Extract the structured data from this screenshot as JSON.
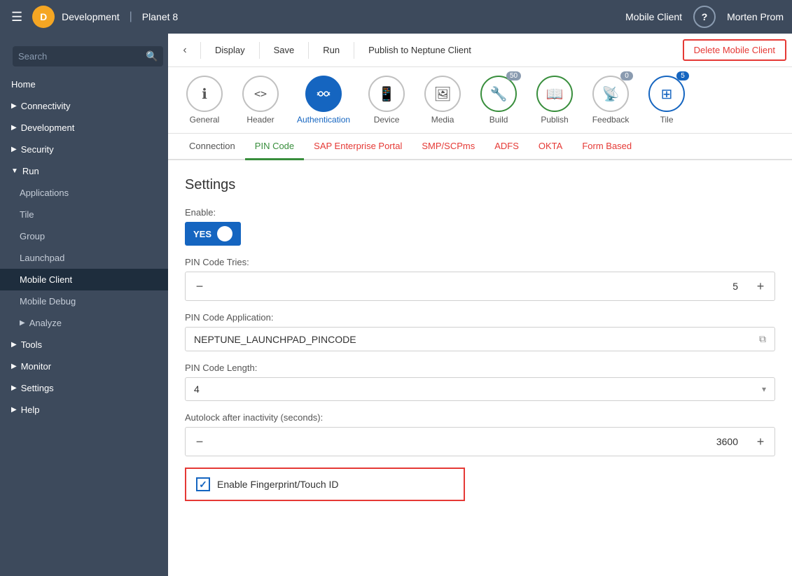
{
  "topbar": {
    "logo_text": "D",
    "environment": "Development",
    "separator": "|",
    "project": "Planet 8",
    "mobile_client": "Mobile Client",
    "help_label": "?",
    "user": "Morten Prom"
  },
  "sidebar": {
    "search_placeholder": "Search",
    "items": [
      {
        "id": "home",
        "label": "Home",
        "expandable": false,
        "indent": 0
      },
      {
        "id": "connectivity",
        "label": "Connectivity",
        "expandable": true,
        "indent": 0
      },
      {
        "id": "development",
        "label": "Development",
        "expandable": true,
        "indent": 0
      },
      {
        "id": "security",
        "label": "Security",
        "expandable": true,
        "indent": 0
      },
      {
        "id": "run",
        "label": "Run",
        "expandable": true,
        "indent": 0,
        "expanded": true
      },
      {
        "id": "applications",
        "label": "Applications",
        "expandable": false,
        "indent": 1
      },
      {
        "id": "tile",
        "label": "Tile",
        "expandable": false,
        "indent": 1
      },
      {
        "id": "group",
        "label": "Group",
        "expandable": false,
        "indent": 1
      },
      {
        "id": "launchpad",
        "label": "Launchpad",
        "expandable": false,
        "indent": 1
      },
      {
        "id": "mobile-client",
        "label": "Mobile Client",
        "expandable": false,
        "indent": 1,
        "active": true
      },
      {
        "id": "mobile-debug",
        "label": "Mobile Debug",
        "expandable": false,
        "indent": 1
      },
      {
        "id": "analyze",
        "label": "Analyze",
        "expandable": true,
        "indent": 1
      },
      {
        "id": "tools",
        "label": "Tools",
        "expandable": true,
        "indent": 0
      },
      {
        "id": "monitor",
        "label": "Monitor",
        "expandable": true,
        "indent": 0
      },
      {
        "id": "settings",
        "label": "Settings",
        "expandable": true,
        "indent": 0
      },
      {
        "id": "help",
        "label": "Help",
        "expandable": true,
        "indent": 0
      }
    ]
  },
  "toolbar": {
    "back_label": "‹",
    "display_label": "Display",
    "save_label": "Save",
    "run_label": "Run",
    "publish_neptune_label": "Publish to Neptune Client",
    "delete_label": "Delete Mobile Client"
  },
  "icon_nav": {
    "items": [
      {
        "id": "general",
        "label": "General",
        "icon": "ℹ",
        "active": false,
        "badge": null,
        "style": "normal"
      },
      {
        "id": "header",
        "label": "Header",
        "icon": "<>",
        "active": false,
        "badge": null,
        "style": "normal"
      },
      {
        "id": "authentication",
        "label": "Authentication",
        "icon": "⇄",
        "active": true,
        "badge": null,
        "style": "active"
      },
      {
        "id": "device",
        "label": "Device",
        "icon": "📱",
        "active": false,
        "badge": null,
        "style": "normal"
      },
      {
        "id": "media",
        "label": "Media",
        "icon": "🖼",
        "active": false,
        "badge": null,
        "style": "normal"
      },
      {
        "id": "build",
        "label": "Build",
        "icon": "🔧",
        "active": false,
        "badge": "50",
        "style": "green"
      },
      {
        "id": "publish",
        "label": "Publish",
        "icon": "📖",
        "active": false,
        "badge": null,
        "style": "green"
      },
      {
        "id": "feedback",
        "label": "Feedback",
        "icon": "📡",
        "active": false,
        "badge": "0",
        "style": "normal"
      },
      {
        "id": "tile",
        "label": "Tile",
        "icon": "⊞",
        "active": false,
        "badge": "5",
        "style": "blue"
      }
    ]
  },
  "tabs": {
    "items": [
      {
        "id": "connection",
        "label": "Connection",
        "style": "normal"
      },
      {
        "id": "pin-code",
        "label": "PIN Code",
        "style": "active"
      },
      {
        "id": "sap-enterprise",
        "label": "SAP Enterprise Portal",
        "style": "red"
      },
      {
        "id": "smp-scpms",
        "label": "SMP/SCPms",
        "style": "red"
      },
      {
        "id": "adfs",
        "label": "ADFS",
        "style": "red"
      },
      {
        "id": "okta",
        "label": "OKTA",
        "style": "red"
      },
      {
        "id": "form-based",
        "label": "Form Based",
        "style": "red"
      }
    ]
  },
  "settings": {
    "title": "Settings",
    "enable_label": "Enable:",
    "toggle_yes": "YES",
    "pin_tries_label": "PIN Code Tries:",
    "pin_tries_value": "5",
    "pin_app_label": "PIN Code Application:",
    "pin_app_value": "NEPTUNE_LAUNCHPAD_PINCODE",
    "pin_length_label": "PIN Code Length:",
    "pin_length_value": "4",
    "autolock_label": "Autolock after inactivity (seconds):",
    "autolock_value": "3600",
    "fingerprint_label": "Enable Fingerprint/Touch ID"
  }
}
